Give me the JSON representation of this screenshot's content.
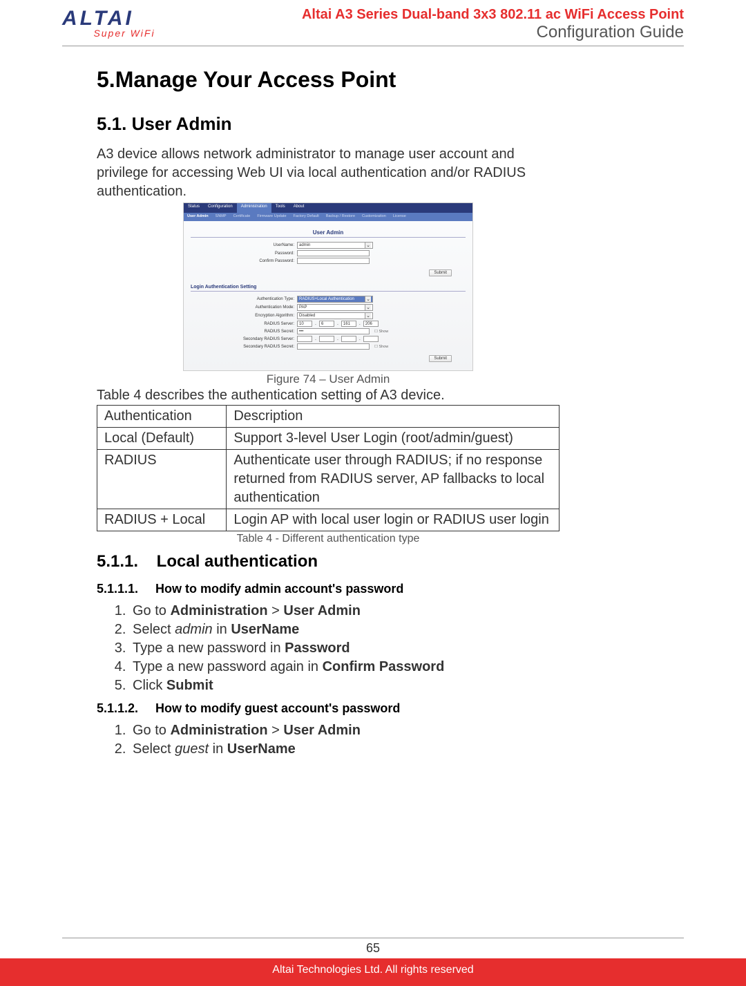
{
  "header": {
    "logo_main": "ALTAI",
    "logo_sub": "Super WiFi",
    "title_line1": "Altai A3 Series Dual-band 3x3 802.11 ac WiFi Access Point",
    "title_line2": "Configuration Guide"
  },
  "h1": "5.Manage Your Access Point",
  "h2": "5.1.  User Admin",
  "intro": "A3 device allows network administrator to manage user account and privilege for accessing Web UI via local authentication and/or RADIUS authentication.",
  "screenshot": {
    "tabs": [
      "Status",
      "Configuration",
      "Administration",
      "Tools",
      "About"
    ],
    "subtabs": [
      "User Admin",
      "SNMP",
      "Certificate",
      "Firmware Update",
      "Factory Default",
      "Backup / Restore",
      "Customization",
      "License"
    ],
    "section1": "User Admin",
    "fields1": {
      "username_label": "UserName:",
      "username_value": "admin",
      "password_label": "Password:",
      "confirm_label": "Confirm Password:"
    },
    "submit": "Submit",
    "section2": "Login Authentication Setting",
    "fields2": {
      "auth_type_label": "Authentication Type:",
      "auth_type_value": "RADIUS+Local Authentication",
      "auth_mode_label": "Authentication Mode:",
      "auth_mode_value": "PAP",
      "enc_label": "Encryption Algorithm:",
      "enc_value": "Disabled",
      "radius_server_label": "RADIUS Server:",
      "radius_ip": [
        "10",
        "6",
        "161",
        "206"
      ],
      "radius_secret_label": "RADIUS Secret:",
      "radius_secret_value": "•••",
      "sec_server_label": "Secondary RADIUS Server:",
      "sec_secret_label": "Secondary RADIUS Secret:",
      "show": "Show"
    }
  },
  "fig_caption": "Figure 74 – User Admin",
  "table_desc": "Table 4 describes the authentication setting of A3 device.",
  "table": {
    "h1": "Authentication",
    "h2": "Description",
    "rows": [
      {
        "a": "Local (Default)",
        "d": "Support 3-level User Login (root/admin/guest)"
      },
      {
        "a": "RADIUS",
        "d": "Authenticate user through RADIUS; if no response returned from RADIUS server, AP fallbacks to local authentication"
      },
      {
        "a": "RADIUS + Local",
        "d": "Login AP with local user login or RADIUS user login"
      }
    ]
  },
  "table_caption": "Table 4 - Different authentication type",
  "h3": {
    "num": "5.1.1.",
    "title": "Local authentication"
  },
  "h4a": {
    "num": "5.1.1.1.",
    "title": "How to modify admin account's password"
  },
  "steps_a": {
    "s1_a": "Go to ",
    "s1_b": "Administration",
    "s1_c": " > ",
    "s1_d": "User Admin",
    "s2_a": "Select ",
    "s2_b": "admin",
    "s2_c": " in ",
    "s2_d": "UserName",
    "s3_a": "Type a new password in ",
    "s3_b": "Password",
    "s4_a": "Type a new password again in ",
    "s4_b": "Confirm Password",
    "s5_a": "Click ",
    "s5_b": "Submit"
  },
  "h4b": {
    "num": "5.1.1.2.",
    "title": "How to modify guest account's password"
  },
  "steps_b": {
    "s1_a": "Go to ",
    "s1_b": "Administration",
    "s1_c": " > ",
    "s1_d": "User Admin",
    "s2_a": "Select ",
    "s2_b": "guest",
    "s2_c": " in ",
    "s2_d": "UserName"
  },
  "footer": {
    "page": "65",
    "copyright": "Altai Technologies Ltd. All rights reserved"
  }
}
